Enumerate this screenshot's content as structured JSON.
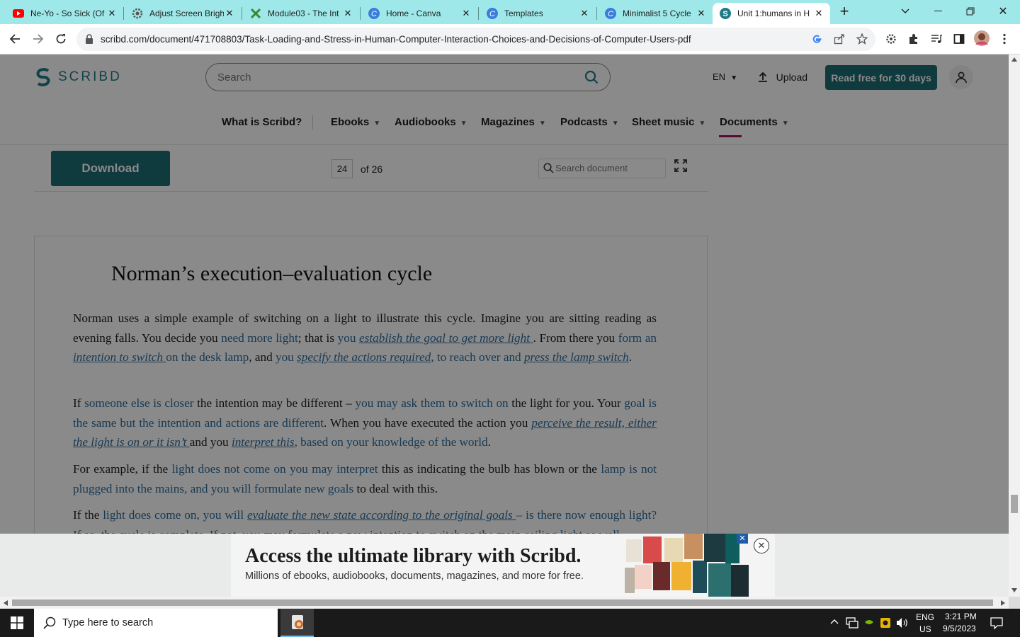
{
  "browser": {
    "tabs": [
      {
        "title": "Ne-Yo - So Sick (Of",
        "icon": "youtube-icon"
      },
      {
        "title": "Adjust Screen Brigh",
        "icon": "gear-icon"
      },
      {
        "title": "Module03 - The Int",
        "icon": "module-icon"
      },
      {
        "title": "Home - Canva",
        "icon": "canva-icon"
      },
      {
        "title": "Templates",
        "icon": "canva-icon"
      },
      {
        "title": "Minimalist 5 Cycle",
        "icon": "canva-icon"
      },
      {
        "title": "Unit 1:humans in H",
        "icon": "scribd-icon",
        "active": true
      }
    ],
    "url": "scribd.com/document/471708803/Task-Loading-and-Stress-in-Human-Computer-Interaction-Choices-and-Decisions-of-Computer-Users-pdf"
  },
  "scribd": {
    "logo": "SCRIBD",
    "search_placeholder": "Search",
    "lang": "EN",
    "upload": "Upload",
    "read_free": "Read free for 30 days",
    "nav": [
      {
        "label": "What is Scribd?",
        "dropdown": false
      },
      {
        "label": "Ebooks",
        "dropdown": true
      },
      {
        "label": "Audiobooks",
        "dropdown": true
      },
      {
        "label": "Magazines",
        "dropdown": true
      },
      {
        "label": "Podcasts",
        "dropdown": true
      },
      {
        "label": "Sheet music",
        "dropdown": true
      },
      {
        "label": "Documents",
        "dropdown": true,
        "active": true
      }
    ],
    "download": "Download",
    "page_current": "24",
    "page_of": "of 26",
    "doc_search_placeholder": "Search document"
  },
  "document": {
    "title": "Norman’s execution–evaluation cycle",
    "paragraphs": [
      [
        {
          "t": "Norman uses a simple example of switching on a light to illustrate this cycle. Imagine you are sitting reading as evening falls. You decide you "
        },
        {
          "t": "need more light",
          "s": "hl"
        },
        {
          "t": "; that is "
        },
        {
          "t": "you ",
          "s": "hl"
        },
        {
          "t": "establish the goal to get more light ",
          "s": "hu"
        },
        {
          "t": ". From there you "
        },
        {
          "t": "form an ",
          "s": "hl"
        },
        {
          "t": "intention to switch ",
          "s": "hu"
        },
        {
          "t": "on the desk lamp",
          "s": "hl"
        },
        {
          "t": ", and "
        },
        {
          "t": "you ",
          "s": "hl"
        },
        {
          "t": "specify the actions required",
          "s": "hu"
        },
        {
          "t": ", to reach over and ",
          "s": "hl"
        },
        {
          "t": "press the lamp switch",
          "s": "hu"
        },
        {
          "t": "."
        }
      ],
      [
        {
          "t": "If "
        },
        {
          "t": "someone else is closer",
          "s": "hl"
        },
        {
          "t": " the intention may be different – "
        },
        {
          "t": "you may ask them to switch on",
          "s": "hl"
        },
        {
          "t": " the light for you. Your "
        },
        {
          "t": "goal is the same but the intention and actions are different",
          "s": "hl"
        },
        {
          "t": ". When you have executed the action you "
        },
        {
          "t": "perceive the result, either the light is on or it isn’t ",
          "s": "hu"
        },
        {
          "t": "and you "
        },
        {
          "t": "interpret this",
          "s": "hu"
        },
        {
          "t": ", based on your knowledge of the world",
          "s": "hl"
        },
        {
          "t": "."
        }
      ],
      [
        {
          "t": "For example, if the "
        },
        {
          "t": "light does not come on you may interpret",
          "s": "hl"
        },
        {
          "t": " this as indicating the bulb has blown or the "
        },
        {
          "t": "lamp is not plugged into the mains, and you will formulate new goals",
          "s": "hl"
        },
        {
          "t": " to deal with this."
        }
      ],
      [
        {
          "t": "If the "
        },
        {
          "t": "light does come on, you will ",
          "s": "hl"
        },
        {
          "t": "evaluate the new state according to the original goals ",
          "s": "hu"
        },
        {
          "t": " – is there now enough light? If so, the cycle is complete. If not, you may formulate a new intention to switch on the main ceiling light as well.",
          "s": "hl"
        }
      ]
    ]
  },
  "banner": {
    "title": "Access the ultimate library with Scribd.",
    "subtitle": "Millions of ebooks, audiobooks, documents, magazines, and more for free."
  },
  "taskbar": {
    "search_text": "Type here to search",
    "lang_top": "ENG",
    "lang_bottom": "US",
    "time": "3:21 PM",
    "date": "9/5/2023"
  },
  "colors": {
    "accent": "#1c6b73",
    "link": "#2f6c9c",
    "nav_active": "#a9145d",
    "tabstrip": "#9fe8e9"
  }
}
